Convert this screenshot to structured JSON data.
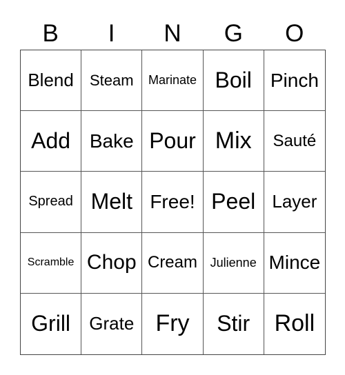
{
  "header": {
    "letters": [
      "B",
      "I",
      "N",
      "G",
      "O"
    ]
  },
  "grid": {
    "cells": [
      [
        "Blend",
        "Steam",
        "Marinate",
        "Boil",
        "Pinch"
      ],
      [
        "Add",
        "Bake",
        "Pour",
        "Mix",
        "Sauté"
      ],
      [
        "Spread",
        "Melt",
        "Free!",
        "Peel",
        "Layer"
      ],
      [
        "Scramble",
        "Chop",
        "Cream",
        "Julienne",
        "Mince"
      ],
      [
        "Grill",
        "Grate",
        "Fry",
        "Stir",
        "Roll"
      ]
    ]
  }
}
